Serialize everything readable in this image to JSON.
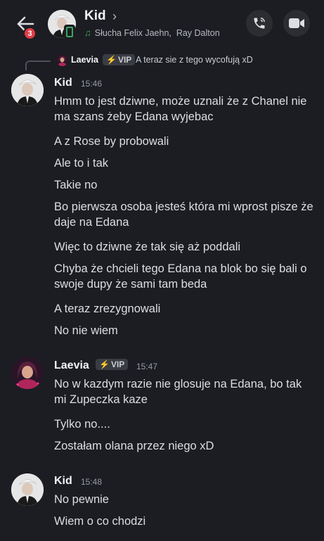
{
  "header": {
    "back_icon": "arrow-left-icon",
    "unread_count": "3",
    "name": "Kid",
    "chevron": "›",
    "activity_prefix": "Słucha",
    "activity_artist1": "Felix Jaehn,",
    "activity_artist2": "Ray Dalton",
    "status_color": "#3ba55d",
    "call_icon": "phone-icon",
    "video_icon": "video-camera-icon"
  },
  "reply": {
    "author": "Laevia",
    "badge": "VIP",
    "text": "A teraz sie z tego wycofują xD"
  },
  "groups": [
    {
      "author": "Kid",
      "time": "15:46",
      "messages": [
        "Hmm to jest dziwne, może uznali że z Chanel nie ma szans żeby Edana wyjebac",
        "A z Rose by probowali",
        "Ale to i tak",
        "Takie no",
        "Bo pierwsza osoba jesteś która mi wprost pisze że daje na Edana",
        "Więc to dziwne że tak się aż poddali",
        "Chyba że chcieli tego Edana na blok bo się bali o swoje dupy że sami tam beda",
        "A teraz zrezygnowali",
        "No nie wiem"
      ]
    },
    {
      "author": "Laevia",
      "badge": "VIP",
      "time": "15:47",
      "messages": [
        "No w kazdym razie nie glosuje na Edana, bo tak mi Zupeczka kaze",
        "Tylko no....",
        "Zostałam olana przez niego xD"
      ]
    },
    {
      "author": "Kid",
      "time": "15:48",
      "messages": [
        "No pewnie",
        "Wiem o co chodzi"
      ]
    }
  ]
}
